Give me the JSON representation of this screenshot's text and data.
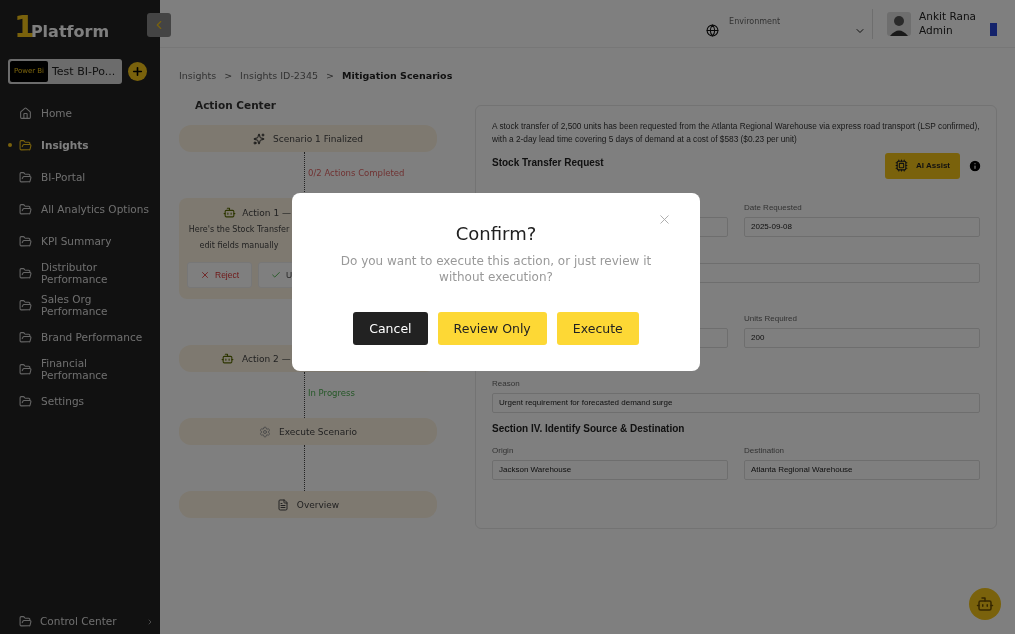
{
  "brand": {
    "mark": "1",
    "name": "Platform"
  },
  "workspace": {
    "badge": "Power Bi",
    "name": "Test BI-Po..."
  },
  "sidebar": {
    "items": [
      {
        "label": "Home",
        "selected": false
      },
      {
        "label": "Insights",
        "selected": true
      },
      {
        "label": "BI-Portal",
        "selected": false
      },
      {
        "label": "All Analytics Options",
        "selected": false
      },
      {
        "label": "KPI Summary",
        "selected": false
      },
      {
        "label": "Distributor Performance",
        "selected": false
      },
      {
        "label": "Sales Org Performance",
        "selected": false
      },
      {
        "label": "Brand Performance",
        "selected": false
      },
      {
        "label": "Financial Performance",
        "selected": false
      },
      {
        "label": "Settings",
        "selected": false
      }
    ],
    "footer": {
      "label": "Control Center"
    }
  },
  "header": {
    "environment": "Environment",
    "user": {
      "name": "Ankit Rana",
      "role": "Admin"
    }
  },
  "breadcrumbs": [
    {
      "kind": "crumb",
      "label": "Insights",
      "current": false
    },
    {
      "kind": "separator",
      "label": ">"
    },
    {
      "kind": "crumb",
      "label": "Insights ID-2345",
      "current": false
    },
    {
      "kind": "separator",
      "label": ">"
    },
    {
      "kind": "crumb",
      "label": "Mitigation Scenarios",
      "current": true
    }
  ],
  "action_center": {
    "title": "Action Center",
    "steps": [
      {
        "kind": "step",
        "label": "Scenario 1 Finalized"
      },
      {
        "kind": "pending",
        "label": "0/2 Actions Completed"
      },
      {
        "kind": "action",
        "label": "Action 1 —",
        "description": [
          "Here's the Stock Transfer",
          "edit fields manually"
        ],
        "buttons": [
          {
            "kind": "reject",
            "label": "Reject"
          },
          {
            "kind": "accept",
            "label": "U"
          }
        ]
      },
      {
        "kind": "connector"
      },
      {
        "kind": "covered_step",
        "label": "Action 2 —"
      },
      {
        "kind": "progress",
        "label": "In Progress"
      },
      {
        "kind": "step",
        "label": "Execute Scenario"
      },
      {
        "kind": "connector"
      },
      {
        "kind": "step",
        "label": "Overview"
      }
    ]
  },
  "detail": {
    "summary": "A stock transfer of 2,500 units has been requested from the Atlanta Regional Warehouse via express road transport (LSP confirmed), with a 2-day lead time covering 5 days of demand at a cost of $583 ($0.23 per unit)",
    "title": "Stock Transfer Request",
    "ai_button": "AI Assist",
    "form": [
      {
        "kind": "row",
        "fields": [
          {
            "kind": "blank"
          },
          {
            "kind": "field",
            "label": "Date Requested",
            "value": "2025-09-08"
          }
        ]
      },
      {
        "kind": "row",
        "fields": [
          {
            "kind": "blank"
          }
        ]
      },
      {
        "kind": "row",
        "fields": [
          {
            "kind": "blank"
          },
          {
            "kind": "field",
            "label": "Units Required",
            "value": "200"
          }
        ]
      },
      {
        "kind": "row",
        "fields": [
          {
            "kind": "field",
            "label": "Reason",
            "value": "Urgent requirement for forecasted demand surge"
          }
        ]
      },
      {
        "kind": "heading",
        "label": "Section IV. Identify Source & Destination"
      },
      {
        "kind": "row",
        "fields": [
          {
            "kind": "field",
            "label": "Origin",
            "value": "Jackson Warehouse"
          },
          {
            "kind": "field",
            "label": "Destination",
            "value": "Atlanta Regional Warehouse"
          }
        ]
      }
    ]
  },
  "dialog": {
    "title": "Confirm?",
    "message": "Do you want to execute this action, or just review it without execution?",
    "buttons": [
      {
        "kind": "dark",
        "label": "Cancel"
      },
      {
        "kind": "accent",
        "label": "Review Only"
      },
      {
        "kind": "accent",
        "label": "Execute"
      }
    ]
  }
}
